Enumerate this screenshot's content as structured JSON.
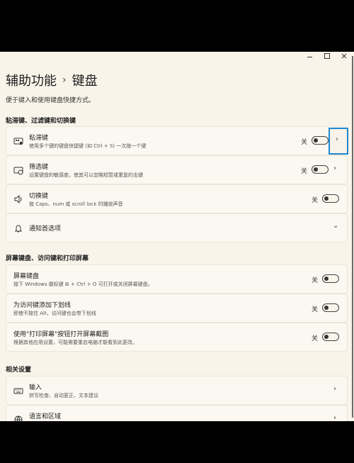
{
  "window": {
    "title_buttons": [
      "minimize",
      "maximize",
      "close"
    ]
  },
  "breadcrumb": {
    "parent": "辅助功能",
    "separator": "›",
    "current": "键盘"
  },
  "description": "便于键入和使用键盘快捷方式。",
  "sections": {
    "sticky": "粘滞键、过滤键和切换键",
    "screen": "屏幕键盘、访问键和打印屏幕",
    "related": "相关设置"
  },
  "items": {
    "sticky_keys": {
      "title": "粘滞键",
      "subtitle": "使用多个键的键盘快捷键 (如 Ctrl + S) 一次按一个键",
      "state": "关"
    },
    "filter_keys": {
      "title": "筛选键",
      "subtitle": "设置键盘的敏感度，使其可以忽略短暂或重复的击键",
      "state": "关"
    },
    "toggle_keys": {
      "title": "切换键",
      "subtitle": "按 Caps、num 或 scroll lock 时播放声音",
      "state": "关"
    },
    "notifications": {
      "title": "通知首选项"
    },
    "onscreen_keyboard": {
      "title": "屏幕键盘",
      "subtitle": "按下 Windows 徽标键 ⊞ + Ctrl + O 可打开或关闭屏幕键盘。",
      "state": "关"
    },
    "underline_access": {
      "title": "为访问键添加下划线",
      "subtitle": "即使不按住 Alt，访问键也会带下划线",
      "state": "关"
    },
    "printscreen": {
      "title": "使用\"打印屏幕\"按钮打开屏幕截图",
      "subtitle": "根据其他应用设置，可能需要重启电脑才能看到此更改。",
      "state": "关"
    },
    "typing": {
      "title": "输入",
      "subtitle": "拼写检查、自动更正、文本建议"
    },
    "language": {
      "title": "语言和区域"
    }
  },
  "icons": {
    "chevron_right": "›",
    "chevron_down": "⌄"
  },
  "colors": {
    "accent_highlight": "#1e88d0",
    "background": "#f8f4ea"
  }
}
